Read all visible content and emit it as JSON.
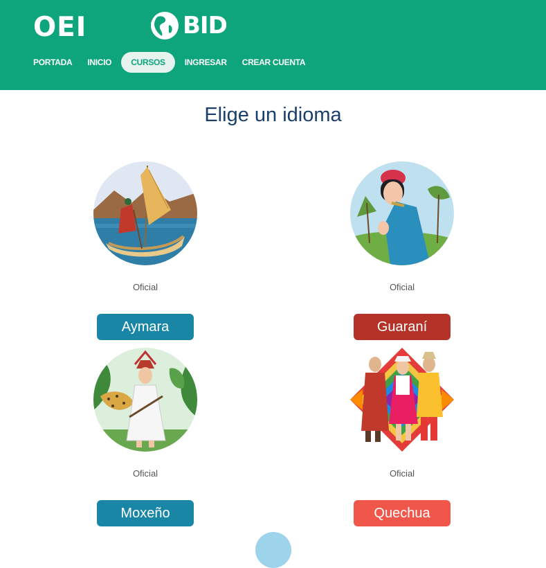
{
  "header": {
    "logo_oei": "OEI",
    "logo_bid": "BID",
    "nav": [
      "PORTADA",
      "INICIO",
      "CURSOS",
      "INGRESAR",
      "CREAR CUENTA"
    ],
    "active_nav": "CURSOS",
    "color": "#0ea47c"
  },
  "page": {
    "title": "Elige un idioma"
  },
  "languages": [
    {
      "name": "Aymara",
      "status": "Oficial",
      "color": "#1a86a5",
      "image": "aymara-sailor-illustration"
    },
    {
      "name": "Guaraní",
      "status": "Oficial",
      "color": "#b43227",
      "image": "guarani-woman-illustration"
    },
    {
      "name": "Moxeño",
      "status": "Oficial",
      "color": "#1a86a5",
      "image": "moxeno-man-jaguar-illustration"
    },
    {
      "name": "Quechua",
      "status": "Oficial",
      "color": "#f0564a",
      "image": "quechua-group-illustration"
    }
  ]
}
